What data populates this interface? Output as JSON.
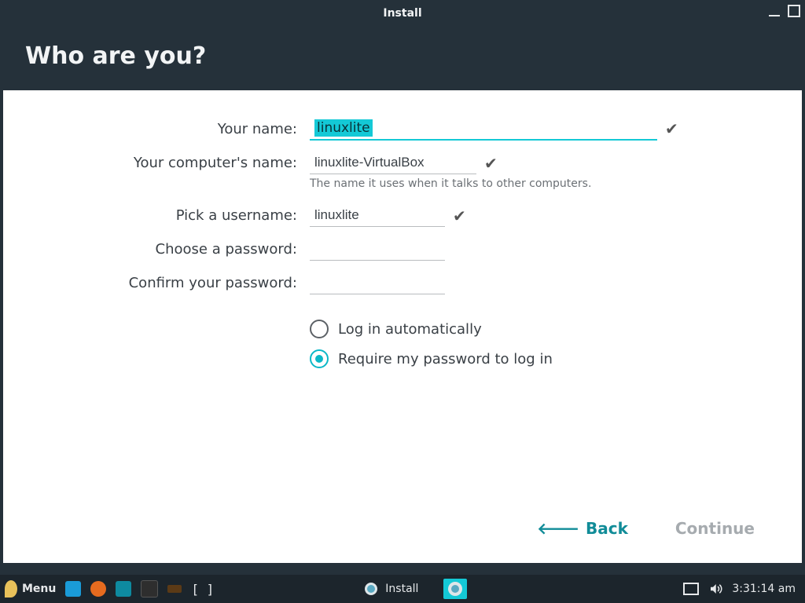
{
  "window": {
    "title": "Install",
    "headline": "Who are you?"
  },
  "form": {
    "name": {
      "label": "Your name:",
      "value": "linuxlite"
    },
    "hostname": {
      "label": "Your computer's name:",
      "value": "linuxlite-VirtualBox",
      "hint": "The name it uses when it talks to other computers."
    },
    "username": {
      "label": "Pick a username:",
      "value": "linuxlite"
    },
    "password": {
      "label": "Choose a password:",
      "value": ""
    },
    "confirm": {
      "label": "Confirm your password:",
      "value": ""
    },
    "radios": {
      "auto": "Log in automatically",
      "require": "Require my password to log in",
      "selected": "require"
    }
  },
  "nav": {
    "back": "Back",
    "continue": "Continue"
  },
  "taskbar": {
    "menu": "Menu",
    "brackets": "[ ]",
    "active_task": "Install",
    "clock": "3:31:14 am"
  }
}
